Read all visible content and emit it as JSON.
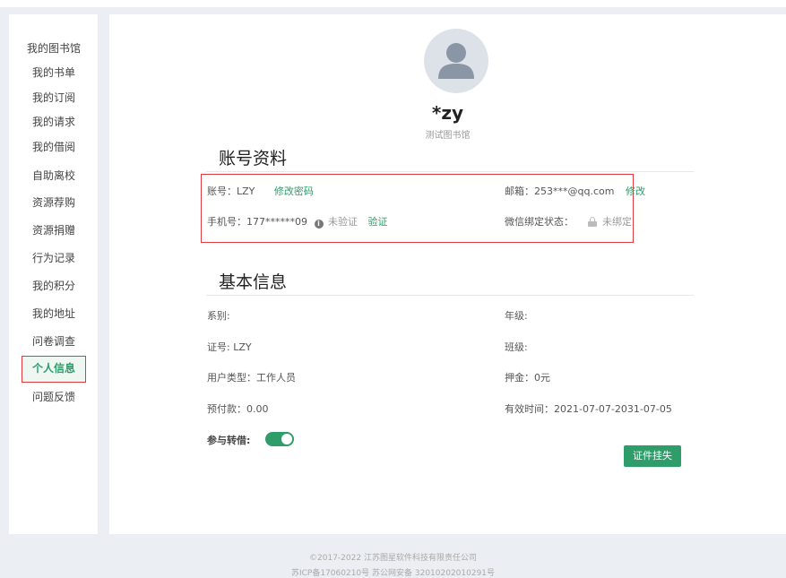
{
  "sidebar": {
    "items": [
      {
        "label": "我的图书馆"
      },
      {
        "label": "我的书单"
      },
      {
        "label": "我的订阅"
      },
      {
        "label": "我的请求"
      },
      {
        "label": "我的借阅"
      },
      {
        "label": "自助离校"
      },
      {
        "label": "资源荐购"
      },
      {
        "label": "资源捐赠"
      },
      {
        "label": "行为记录"
      },
      {
        "label": "我的积分"
      },
      {
        "label": "我的地址"
      },
      {
        "label": "问卷调查"
      },
      {
        "label": "个人信息"
      },
      {
        "label": "问题反馈"
      }
    ],
    "active": "个人信息"
  },
  "profile": {
    "nickname": "*zy",
    "library": "测试图书馆"
  },
  "account": {
    "title": "账号资料",
    "account_label": "账号：LZY",
    "change_password": "修改密码",
    "email_label": "邮箱：253***@qq.com",
    "email_edit": "修改",
    "phone_label": "手机号：177******09",
    "phone_status": "未验证",
    "phone_verify": "验证",
    "wechat_label": "微信绑定状态：",
    "wechat_status": "未绑定"
  },
  "basic": {
    "title": "基本信息",
    "dept": "系别:",
    "grade": "年级:",
    "card_no": "证号: LZY",
    "class": "班级:",
    "user_type": "用户类型：工作人员",
    "deposit": "押金：0元",
    "prepaid": "预付款：0.00",
    "valid_time": "有效时间：2021-07-07-2031-07-05",
    "lend_label": "参与转借:",
    "lend_enabled": true,
    "report_loss": "证件挂失"
  },
  "footer": {
    "copyright": "©2017-2022 江苏图星软件科技有限责任公司",
    "icp": "苏ICP备17060210号   苏公网安备 32010202010291号"
  },
  "colors": {
    "accent": "#2e9d6a",
    "highlight": "#e4393c"
  }
}
